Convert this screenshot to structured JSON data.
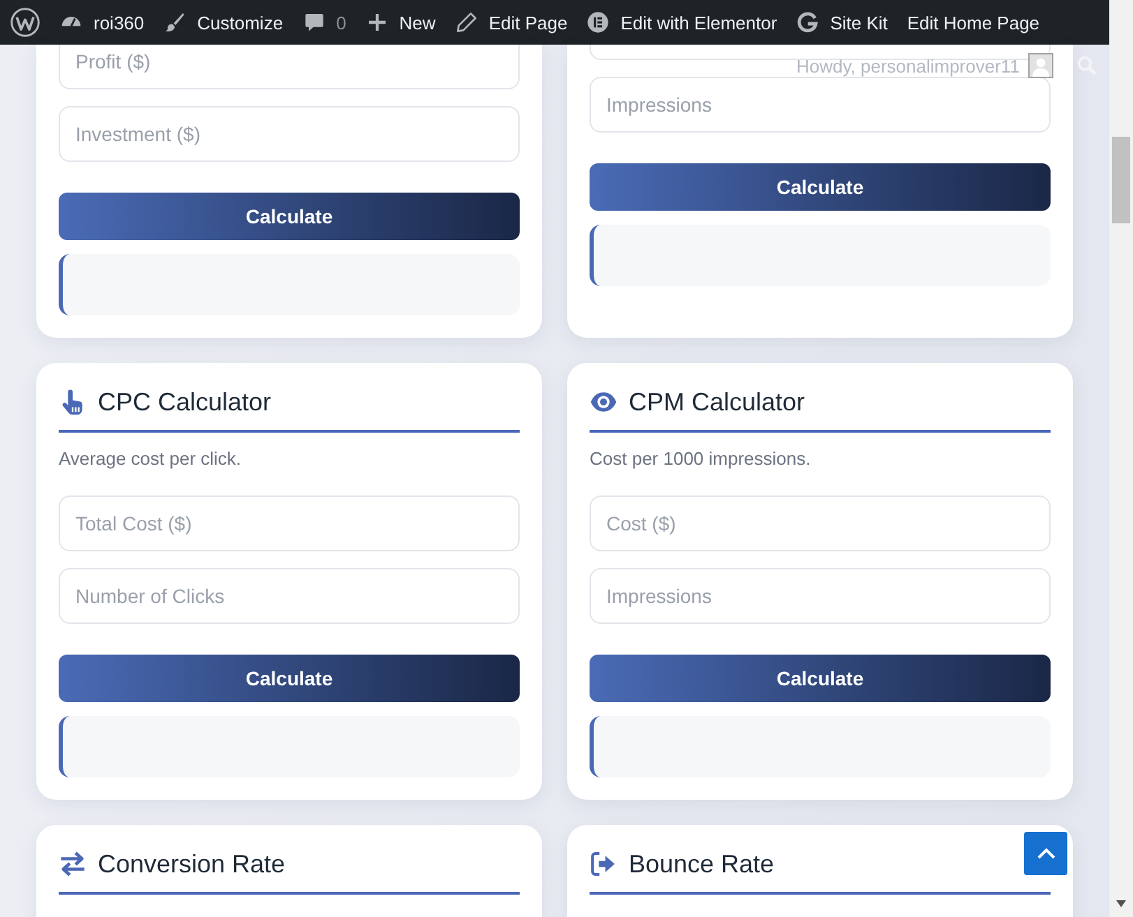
{
  "admin_bar": {
    "items": [
      {
        "kind": "wp-logo"
      },
      {
        "kind": "dashboard",
        "label": "roi360"
      },
      {
        "kind": "brush",
        "label": "Customize"
      },
      {
        "kind": "comments",
        "label": "0"
      },
      {
        "kind": "plus",
        "label": "New"
      },
      {
        "kind": "pencil",
        "label": "Edit Page"
      },
      {
        "kind": "elementor",
        "label": "Edit with Elementor"
      },
      {
        "kind": "google",
        "label": "Site Kit"
      },
      {
        "kind": "plain",
        "label": "Edit Home Page"
      }
    ],
    "greeting": "Howdy, personalimprover11"
  },
  "cards": [
    {
      "fields": [
        {
          "kind": "input",
          "placeholder": "Profit ($)"
        },
        {
          "kind": "input",
          "placeholder": "Investment ($)"
        }
      ],
      "button": "Calculate"
    },
    {
      "fields": [
        {
          "kind": "input"
        },
        {
          "kind": "input",
          "placeholder": "Impressions"
        }
      ],
      "button": "Calculate"
    },
    {
      "kind": "cpc",
      "title": "CPC Calculator",
      "description": "Average cost per click.",
      "fields": [
        {
          "kind": "input",
          "placeholder": "Total Cost ($)"
        },
        {
          "kind": "input",
          "placeholder": "Number of Clicks"
        }
      ],
      "button": "Calculate"
    },
    {
      "kind": "cpm",
      "title": "CPM Calculator",
      "description": "Cost per 1000 impressions.",
      "fields": [
        {
          "kind": "input",
          "placeholder": "Cost ($)"
        },
        {
          "kind": "input",
          "placeholder": "Impressions"
        }
      ],
      "button": "Calculate"
    },
    {
      "kind": "conversion",
      "title": "Conversion Rate"
    },
    {
      "kind": "bounce",
      "title": "Bounce Rate"
    }
  ]
}
